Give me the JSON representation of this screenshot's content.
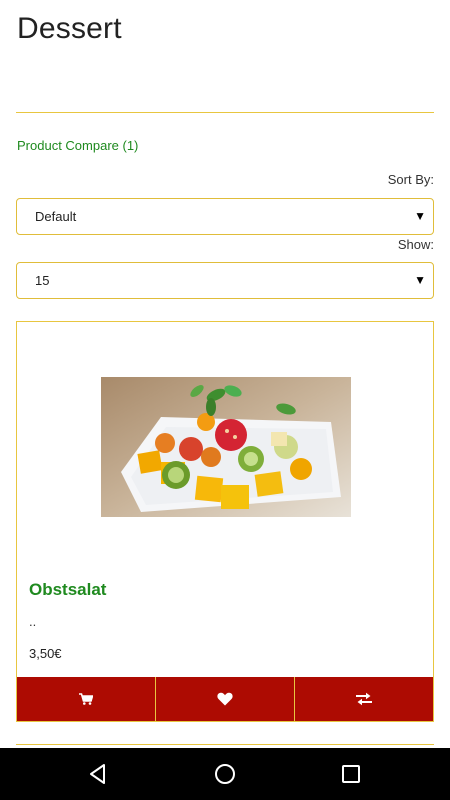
{
  "page": {
    "title": "Dessert",
    "compare_link": "Product Compare (1)"
  },
  "sort": {
    "label": "Sort By:",
    "selected": "Default"
  },
  "show": {
    "label": "Show:",
    "selected": "15"
  },
  "product": {
    "name": "Obstsalat",
    "description": "..",
    "price": "3,50€",
    "image": "fruit-salad-photo",
    "actions": {
      "cart_icon": "cart-icon",
      "wishlist_icon": "heart-icon",
      "compare_icon": "compare-arrows-icon"
    }
  },
  "colors": {
    "accent": "#e8c640",
    "link_green": "#1f8a1f",
    "button_red": "#ad0b02",
    "nav_bar": "#000000"
  },
  "system_nav": {
    "back_icon": "back-triangle-icon",
    "home_icon": "home-circle-icon",
    "recents_icon": "recents-square-icon"
  }
}
